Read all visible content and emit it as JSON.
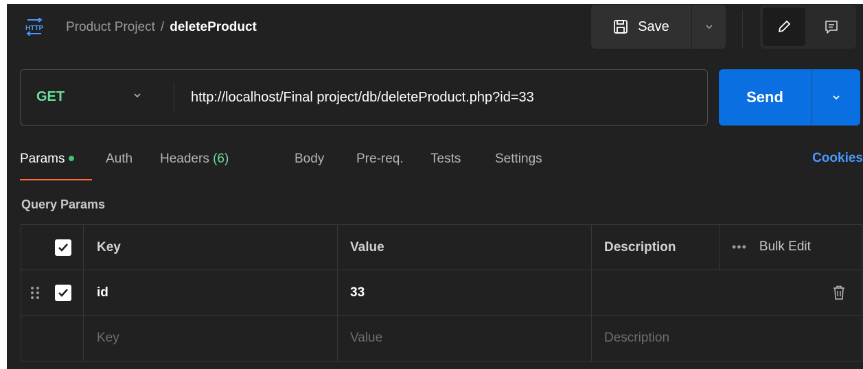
{
  "header": {
    "icon": "http-icon",
    "icon_text": "HTTP",
    "project": "Product Project",
    "separator": "/",
    "request_name": "deleteProduct",
    "save_label": "Save"
  },
  "request": {
    "method": "GET",
    "url": "http://localhost/Final project/db/deleteProduct.php?id=33",
    "send_label": "Send"
  },
  "tabs": [
    {
      "label": "Params",
      "active": true
    },
    {
      "label": "Auth"
    },
    {
      "label": "Headers",
      "count": "(6)"
    },
    {
      "label": "Body"
    },
    {
      "label": "Pre-req."
    },
    {
      "label": "Tests"
    },
    {
      "label": "Settings"
    }
  ],
  "cookies_label": "Cookies",
  "query_params": {
    "title": "Query Params",
    "columns": {
      "key": "Key",
      "value": "Value",
      "description": "Description"
    },
    "actions": {
      "more": "•••",
      "bulk_edit": "Bulk Edit"
    },
    "rows": [
      {
        "key": "id",
        "value": "33",
        "description": "",
        "checked": true
      }
    ],
    "placeholders": {
      "key": "Key",
      "value": "Value",
      "description": "Description"
    }
  },
  "colors": {
    "background": "#212121",
    "method_get": "#6bdd9a",
    "send_button": "#0a6fe0",
    "active_tab_underline": "#ff6c37",
    "cookies_link": "#4a98ff",
    "params_dot": "#3fc17a"
  }
}
